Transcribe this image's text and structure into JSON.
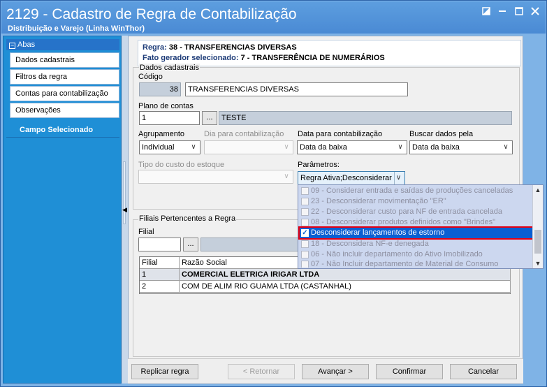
{
  "window": {
    "title": "2129 - Cadastro de Regra de Contabilização",
    "subtitle": "Distribuição e Varejo (Linha WinThor)",
    "controls": [
      "restore-icon",
      "minimize-icon",
      "maximize-icon",
      "close-icon"
    ]
  },
  "sidebar": {
    "header": "Abas",
    "items": [
      {
        "label": "Dados cadastrais"
      },
      {
        "label": "Filtros da regra"
      },
      {
        "label": "Contas para contabilização"
      },
      {
        "label": "Observações"
      }
    ],
    "campo_header": "Campo Selecionado"
  },
  "info": {
    "regra_key": "Regra:",
    "regra_value": "38 - TRANSFERENCIAS DIVERSAS",
    "fato_key": "Fato gerador selecionado:",
    "fato_value": "7 - TRANSFERÊNCIA DE NUMERÁRIOS"
  },
  "form": {
    "section_title": "Dados cadastrais",
    "codigo_label": "Código",
    "codigo_value": "38",
    "descricao_value": "TRANSFERENCIAS DIVERSAS",
    "plano_label": "Plano de contas",
    "plano_value": "1",
    "plano_desc": "TESTE",
    "agrupamento_label": "Agrupamento",
    "agrupamento_value": "Individual",
    "dia_label": "Dia para contabilização",
    "dia_value": "",
    "data_label": "Data para contabilização",
    "data_value": "Data da baixa",
    "buscar_label": "Buscar dados pela",
    "buscar_value": "Data da baixa",
    "tipo_custo_label": "Tipo do custo do estoque",
    "tipo_custo_value": "",
    "parametros_label": "Parâmetros:",
    "parametros_value": "Regra Ativa;Desconsiderar"
  },
  "parametros_options": [
    {
      "label": "09 - Considerar entrada e saídas de produções canceladas",
      "checked": false
    },
    {
      "label": "23 - Desconsiderar movimentação \"ER\"",
      "checked": false
    },
    {
      "label": "22 - Desconsiderar custo para NF de entrada cancelada",
      "checked": false
    },
    {
      "label": "08 - Desconsiderar produtos definidos como \"Brindes\"",
      "checked": false
    },
    {
      "label": "Desconsiderar lançamentos de estorno",
      "checked": true,
      "selected": true
    },
    {
      "label": "18 - Desconsidera NF-e denegada",
      "checked": false
    },
    {
      "label": "06 - Não incluir departamento do Ativo Imobilizado",
      "checked": false
    },
    {
      "label": "07 - Não Incluir departamento de Material de Consumo",
      "checked": false
    }
  ],
  "filiais": {
    "section_title": "Filiais Pertencentes a Regra",
    "filial_label": "Filial",
    "filial_value": "",
    "columns": [
      "Filial",
      "Razão Social"
    ],
    "rows": [
      [
        "1",
        "COMERCIAL ELETRICA IRIGAR LTDA"
      ],
      [
        "2",
        "COM DE ALIM RIO GUAMA LTDA (CASTANHAL)"
      ]
    ]
  },
  "buttons": {
    "replicar": "Replicar regra",
    "retornar": "< Retornar",
    "avancar": "Avançar >",
    "confirmar": "Confirmar",
    "cancelar": "Cancelar"
  }
}
